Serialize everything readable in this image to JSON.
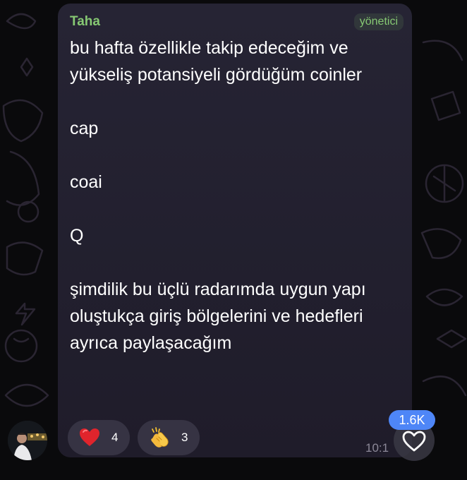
{
  "message": {
    "sender": "Taha",
    "role": "yönetici",
    "paragraphs": [
      "bu hafta özellikle takip edeceğim ve yükseliş potansiyeli gördüğüm coinler",
      "cap",
      "coai",
      "Q",
      "şimdilik bu üçlü radarımda uygun yapı oluştukça giriş bölgelerini ve hedefleri ayrıca paylaşacağım"
    ],
    "time": "10:1",
    "reactions": [
      {
        "emoji": "red-heart-icon",
        "count": "4"
      },
      {
        "emoji": "clapping-hands-icon",
        "count": "3"
      }
    ]
  },
  "views_badge": "1.6K",
  "colors": {
    "sender": "#86c873",
    "bubble": "#262434",
    "reaction_bg": "#363343",
    "badge": "#4e86f7",
    "background": "#0a0a0c"
  }
}
